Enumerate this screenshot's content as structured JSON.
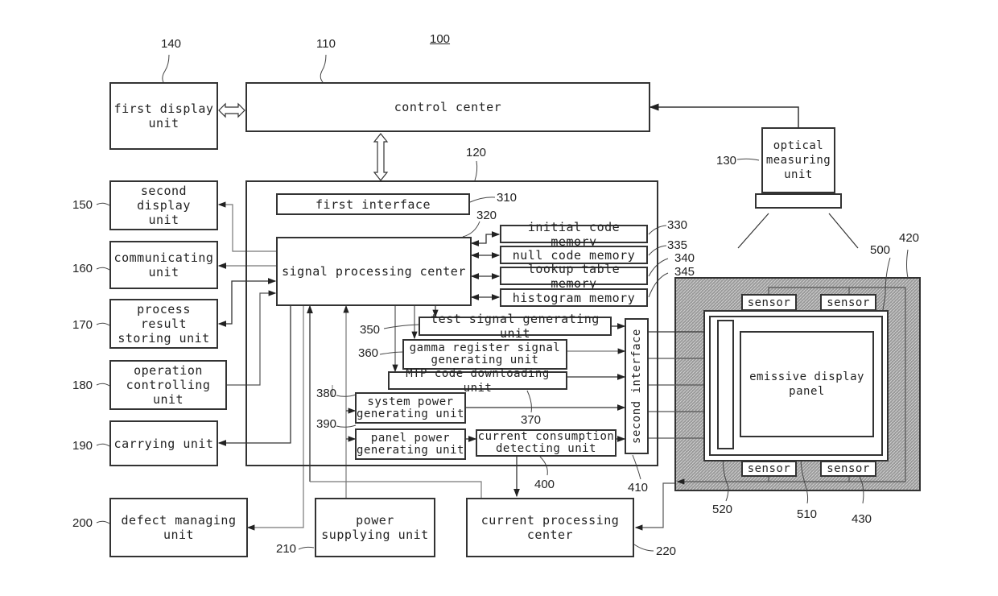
{
  "figure_ref": "100",
  "blocks": {
    "control_center": {
      "label": "control center",
      "ref": "110"
    },
    "signal_block": {
      "ref": "120"
    },
    "optical_measuring": {
      "label": "optical\nmeasuring\nunit",
      "ref": "130"
    },
    "first_display": {
      "label": "first display\nunit",
      "ref": "140"
    },
    "second_display": {
      "label": "second display\nunit",
      "ref": "150"
    },
    "communicating": {
      "label": "communicating\nunit",
      "ref": "160"
    },
    "process_result": {
      "label": "process result\nstoring unit",
      "ref": "170"
    },
    "operation_controlling": {
      "label": "operation\ncontrolling unit",
      "ref": "180"
    },
    "carrying": {
      "label": "carrying unit",
      "ref": "190"
    },
    "defect_managing": {
      "label": "defect managing\nunit",
      "ref": "200"
    },
    "power_supplying": {
      "label": "power\nsupplying unit",
      "ref": "210"
    },
    "current_processing": {
      "label": "current processing\ncenter",
      "ref": "220"
    },
    "first_interface": {
      "label": "first interface",
      "ref": "310"
    },
    "signal_processing": {
      "label": "signal processing center",
      "ref": "320"
    },
    "initial_code_memory": {
      "label": "initial code memory",
      "ref": "330"
    },
    "null_code_memory": {
      "label": "null code memory",
      "ref": "335"
    },
    "lookup_table_memory": {
      "label": "lookup table memory",
      "ref": "340"
    },
    "histogram_memory": {
      "label": "histogram memory",
      "ref": "345"
    },
    "test_signal": {
      "label": "test signal generating unit",
      "ref": "350"
    },
    "gamma_register": {
      "label": "gamma register signal\ngenerating unit",
      "ref": "360"
    },
    "mtp_code": {
      "label": "MTP code downloading unit",
      "ref": "370"
    },
    "system_power": {
      "label": "system power\ngenerating unit",
      "ref": "380"
    },
    "panel_power": {
      "label": "panel power\ngenerating unit",
      "ref": "390"
    },
    "current_consumption": {
      "label": "current consumption\ndetecting unit",
      "ref": "400"
    },
    "second_interface": {
      "label": "second interface",
      "ref": "410"
    },
    "stage": {
      "ref": "420"
    },
    "sensors": {
      "label": "sensor",
      "ref": "430"
    },
    "panel_module": {
      "ref": "500"
    },
    "emissive_panel": {
      "label": "emissive display\npanel",
      "ref": "510"
    },
    "driver": {
      "ref": "520"
    }
  }
}
